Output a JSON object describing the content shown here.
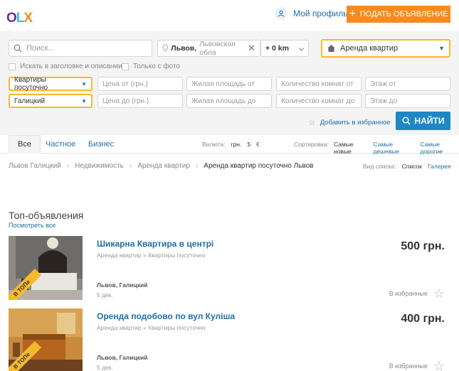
{
  "header": {
    "logo": "OLX",
    "profile_label": "Мой профиль",
    "post_button": "ПОДАТЬ ОБЪЯВЛЕНИЕ",
    "accent_color": "#f58b1f"
  },
  "search": {
    "query_placeholder": "Поиск...",
    "location_value": "Львов,",
    "location_region": "Львовская обла",
    "radius": "+ 0 km",
    "category": "Аренда квартир",
    "only_title_label": "Искать в заголовке и описании",
    "only_photo_label": "Только с фото",
    "subcategory": "Квартиры посуточно",
    "district": "Галицкий",
    "price_from": "Цена от (грн.)",
    "price_to": "Цена до (грн.)",
    "area_from": "Жилая площадь от",
    "area_to": "Жилая площадь до",
    "rooms_from": "Количество комнат от",
    "rooms_to": "Количество комнат до",
    "floor_from": "Этаж от",
    "floor_to": "Этаж до",
    "save_favorite": "Добавить в избранное",
    "find_button": "НАЙТИ",
    "find_color": "#1e88c7"
  },
  "tabs": {
    "all": "Все",
    "private": "Частное",
    "business": "Бизнес",
    "currency_label": "Валюта:",
    "currency_uah": "грн.",
    "currency_usd": "$",
    "currency_eur": "€",
    "sort_label": "Сортировка:",
    "sort_new": "Самые новые",
    "sort_cheap": "Самые дешевые",
    "sort_expensive": "Самые дорогие"
  },
  "breadcrumbs": [
    "Львов Галицкий",
    "Недвижимость",
    "Аренда квартир",
    "Аренда квартир посуточно Львов"
  ],
  "view": {
    "label": "Вид списка:",
    "list": "Список",
    "gallery": "Галерея"
  },
  "top": {
    "title": "Топ-объявления",
    "see_all": "Посмотреть все"
  },
  "listings": [
    {
      "title": "Шикарна Квартира в центрі",
      "category": "Аренда квартир » Квартиры посуточно",
      "location": "Львов, Галицкий",
      "date": "5 дек.",
      "price": "500 грн.",
      "favorite": "В избранные",
      "badge": "В ТОПе"
    },
    {
      "title": "Оренда подобово по вул Куліша",
      "category": "Аренда квартир » Квартиры посуточно",
      "location": "Львов, Галицкий",
      "date": "5 дек.",
      "price": "400 грн.",
      "favorite": "В избранные",
      "badge": "В ТОПе"
    }
  ]
}
